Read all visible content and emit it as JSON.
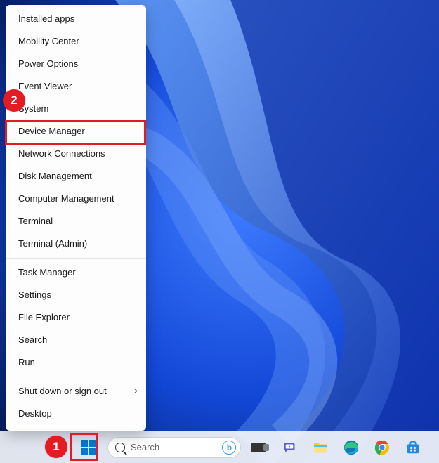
{
  "menu": {
    "groups": [
      [
        {
          "id": "installed-apps",
          "label": "Installed apps"
        },
        {
          "id": "mobility-center",
          "label": "Mobility Center"
        },
        {
          "id": "power-options",
          "label": "Power Options"
        },
        {
          "id": "event-viewer",
          "label": "Event Viewer"
        },
        {
          "id": "system",
          "label": "System"
        },
        {
          "id": "device-manager",
          "label": "Device Manager"
        },
        {
          "id": "network-connections",
          "label": "Network Connections"
        },
        {
          "id": "disk-management",
          "label": "Disk Management"
        },
        {
          "id": "computer-management",
          "label": "Computer Management"
        },
        {
          "id": "terminal",
          "label": "Terminal"
        },
        {
          "id": "terminal-admin",
          "label": "Terminal (Admin)"
        }
      ],
      [
        {
          "id": "task-manager",
          "label": "Task Manager"
        },
        {
          "id": "settings",
          "label": "Settings"
        },
        {
          "id": "file-explorer",
          "label": "File Explorer"
        },
        {
          "id": "search",
          "label": "Search"
        },
        {
          "id": "run",
          "label": "Run"
        }
      ],
      [
        {
          "id": "shutdown",
          "label": "Shut down or sign out",
          "submenu": true
        },
        {
          "id": "desktop",
          "label": "Desktop"
        }
      ]
    ]
  },
  "taskbar": {
    "search_placeholder": "Search",
    "bing_label": "b",
    "icons": {
      "start": "start-icon",
      "taskview": "task-view-icon",
      "chat": "chat-icon",
      "explorer": "file-explorer-icon",
      "edge": "edge-icon",
      "chrome": "chrome-icon",
      "store": "microsoft-store-icon"
    }
  },
  "annotations": {
    "step1": "1",
    "step2": "2"
  }
}
